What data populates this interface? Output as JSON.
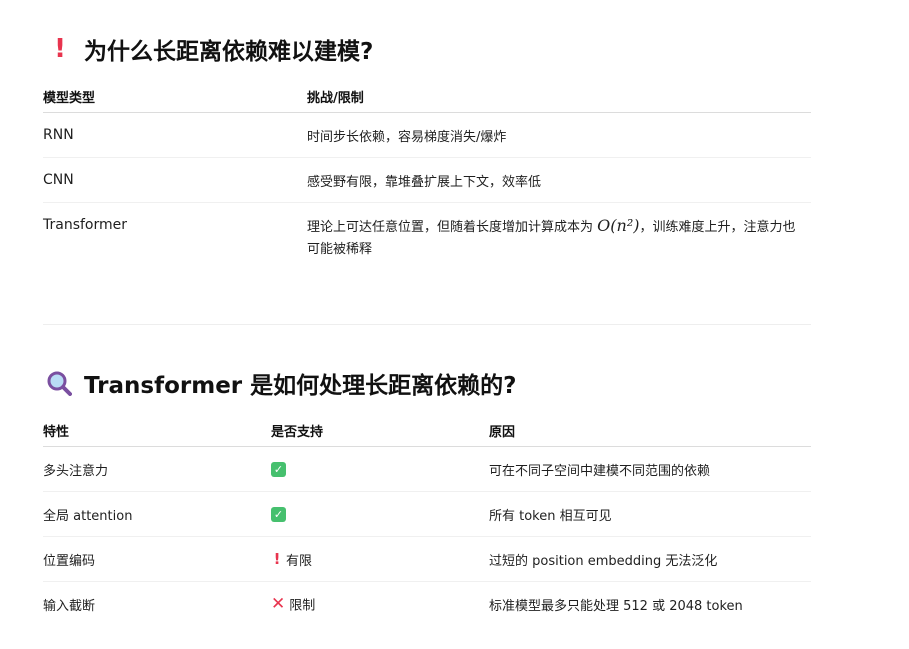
{
  "section1": {
    "icon": "exclamation-icon",
    "title": "为什么长距离依赖难以建模?",
    "headers": [
      "模型类型",
      "挑战/限制"
    ],
    "rows": [
      {
        "model": "RNN",
        "challenge": "时间步长依赖，容易梯度消失/爆炸"
      },
      {
        "model": "CNN",
        "challenge": "感受野有限，靠堆叠扩展上下文，效率低"
      },
      {
        "model": "Transformer",
        "challenge_pre": "理论上可达任意位置，但随着长度增加计算成本为",
        "challenge_math": "O(n²)",
        "challenge_post": "，训练难度上升，注意力也可能被稀释"
      }
    ]
  },
  "section2": {
    "icon": "magnifier-icon",
    "title": "Transformer 是如何处理长距离依赖的?",
    "headers": [
      "特性",
      "是否支持",
      "原因"
    ],
    "rows": [
      {
        "feature": "多头注意力",
        "support_icon": "check-icon",
        "support_text": "",
        "reason": "可在不同子空间中建模不同范围的依赖"
      },
      {
        "feature": "全局 attention",
        "support_icon": "check-icon",
        "support_text": "",
        "reason": "所有 token 相互可见"
      },
      {
        "feature": "位置编码",
        "support_icon": "exclamation-icon",
        "support_text": "有限",
        "reason": "过短的 position embedding 无法泛化"
      },
      {
        "feature": "输入截断",
        "support_icon": "cross-icon",
        "support_text": "限制",
        "reason": "标准模型最多只能处理 512 或 2048 token"
      }
    ]
  },
  "colors": {
    "accent_red": "#e8344e",
    "check_green": "#46c06e"
  }
}
